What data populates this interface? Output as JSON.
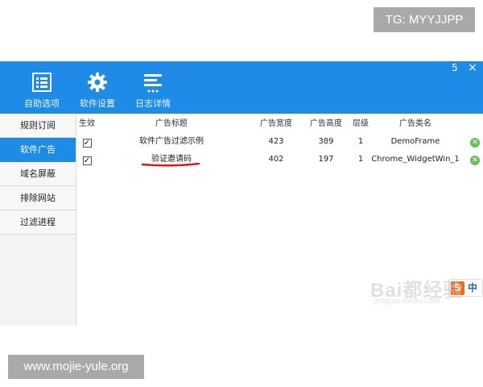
{
  "watermarks": {
    "top_right": "TG: MYYJJPP",
    "bottom_left": "www.mojie-yule.org",
    "baidu_line1": "Bai都经验",
    "baidu_line2": "jingyan.baidu.com"
  },
  "toolbar": {
    "items": [
      {
        "label": "自助选项",
        "icon": "list-icon"
      },
      {
        "label": "软件设置",
        "icon": "gear-icon"
      },
      {
        "label": "日志详情",
        "icon": "log-icon"
      }
    ],
    "minimize_glyph": "5",
    "close_glyph": "×"
  },
  "sidebar": {
    "items": [
      {
        "label": "规则订阅",
        "active": false
      },
      {
        "label": "软件广告",
        "active": true
      },
      {
        "label": "域名屏蔽",
        "active": false
      },
      {
        "label": "排除网站",
        "active": false
      },
      {
        "label": "过滤进程",
        "active": false
      }
    ]
  },
  "table": {
    "headers": {
      "enabled": "生效",
      "title": "广告标题",
      "width": "广告宽度",
      "height": "广告高度",
      "level": "层级",
      "classname": "广告类名"
    },
    "rows": [
      {
        "checked": true,
        "title": "软件广告过滤示例",
        "width": "423",
        "height": "389",
        "level": "1",
        "classname": "DemoFrame"
      },
      {
        "checked": true,
        "title": "验证邀请码",
        "width": "402",
        "height": "197",
        "level": "1",
        "classname": "Chrome_WidgetWin_1"
      }
    ],
    "check_glyph": "✓",
    "delete_glyph": "✕"
  },
  "ime": {
    "logo": "S",
    "mode": "中"
  },
  "colors": {
    "accent": "#1e8be6",
    "sidebar_bg": "#f3f3f3",
    "delete_green": "#6ac05b",
    "underline_red": "#d8191f"
  }
}
